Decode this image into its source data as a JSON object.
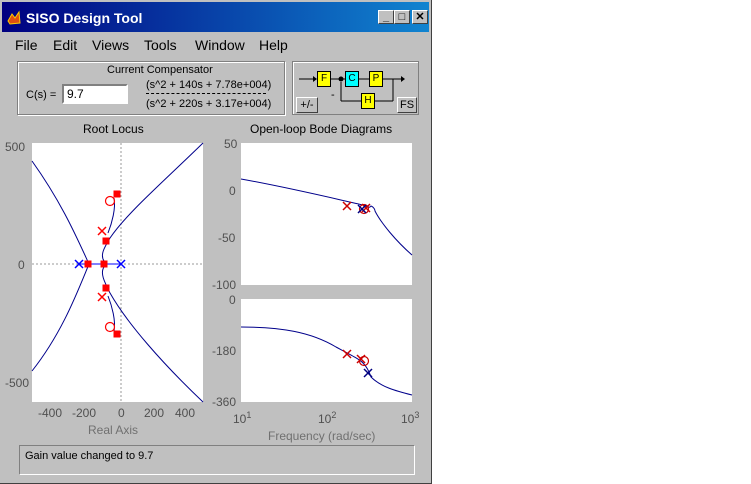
{
  "window": {
    "title": "SISO Design Tool"
  },
  "menu": [
    "File",
    "Edit",
    "Views",
    "Tools",
    "Window",
    "Help"
  ],
  "compensator": {
    "frame_title": "Current Compensator",
    "label": "C(s) =",
    "gain_value": "9.7",
    "numerator": "(s^2 + 140s + 7.78e+004)",
    "denominator": "(s^2 + 220s + 3.17e+004)"
  },
  "block_diagram": {
    "blocks": [
      "F",
      "C",
      "P",
      "H"
    ],
    "sign": "-",
    "sign_button": "+/-",
    "fs_button": "FS",
    "colors": {
      "F": "#ffff00",
      "C": "#00ffff",
      "P": "#ffff00",
      "H": "#ffff00"
    }
  },
  "root_locus": {
    "title": "Root Locus",
    "xlabel": "Real Axis",
    "yticks": [
      "500",
      "0",
      "-500"
    ],
    "xticks": [
      "-400",
      "-200",
      "0",
      "200",
      "400"
    ]
  },
  "bode": {
    "title": "Open-loop Bode Diagrams",
    "xlabel": "Frequency (rad/sec)",
    "mag_ticks": [
      "50",
      "0",
      "-50",
      "-100"
    ],
    "phase_ticks": [
      "0",
      "-180",
      "-360"
    ],
    "freq_ticks": [
      "10",
      "10",
      "10"
    ],
    "freq_exps": [
      "1",
      "2",
      "3"
    ]
  },
  "status": {
    "text": "Gain value changed to 9.7"
  },
  "colors": {
    "curve": "#00008b",
    "pole_marker": "#cc0000",
    "zero_marker": "#cc0000",
    "closed_loop": "#ff0000",
    "axis_line": "#0000ff"
  },
  "icons": [
    "matlab-icon",
    "minimize-icon",
    "maximize-icon",
    "close-icon"
  ]
}
